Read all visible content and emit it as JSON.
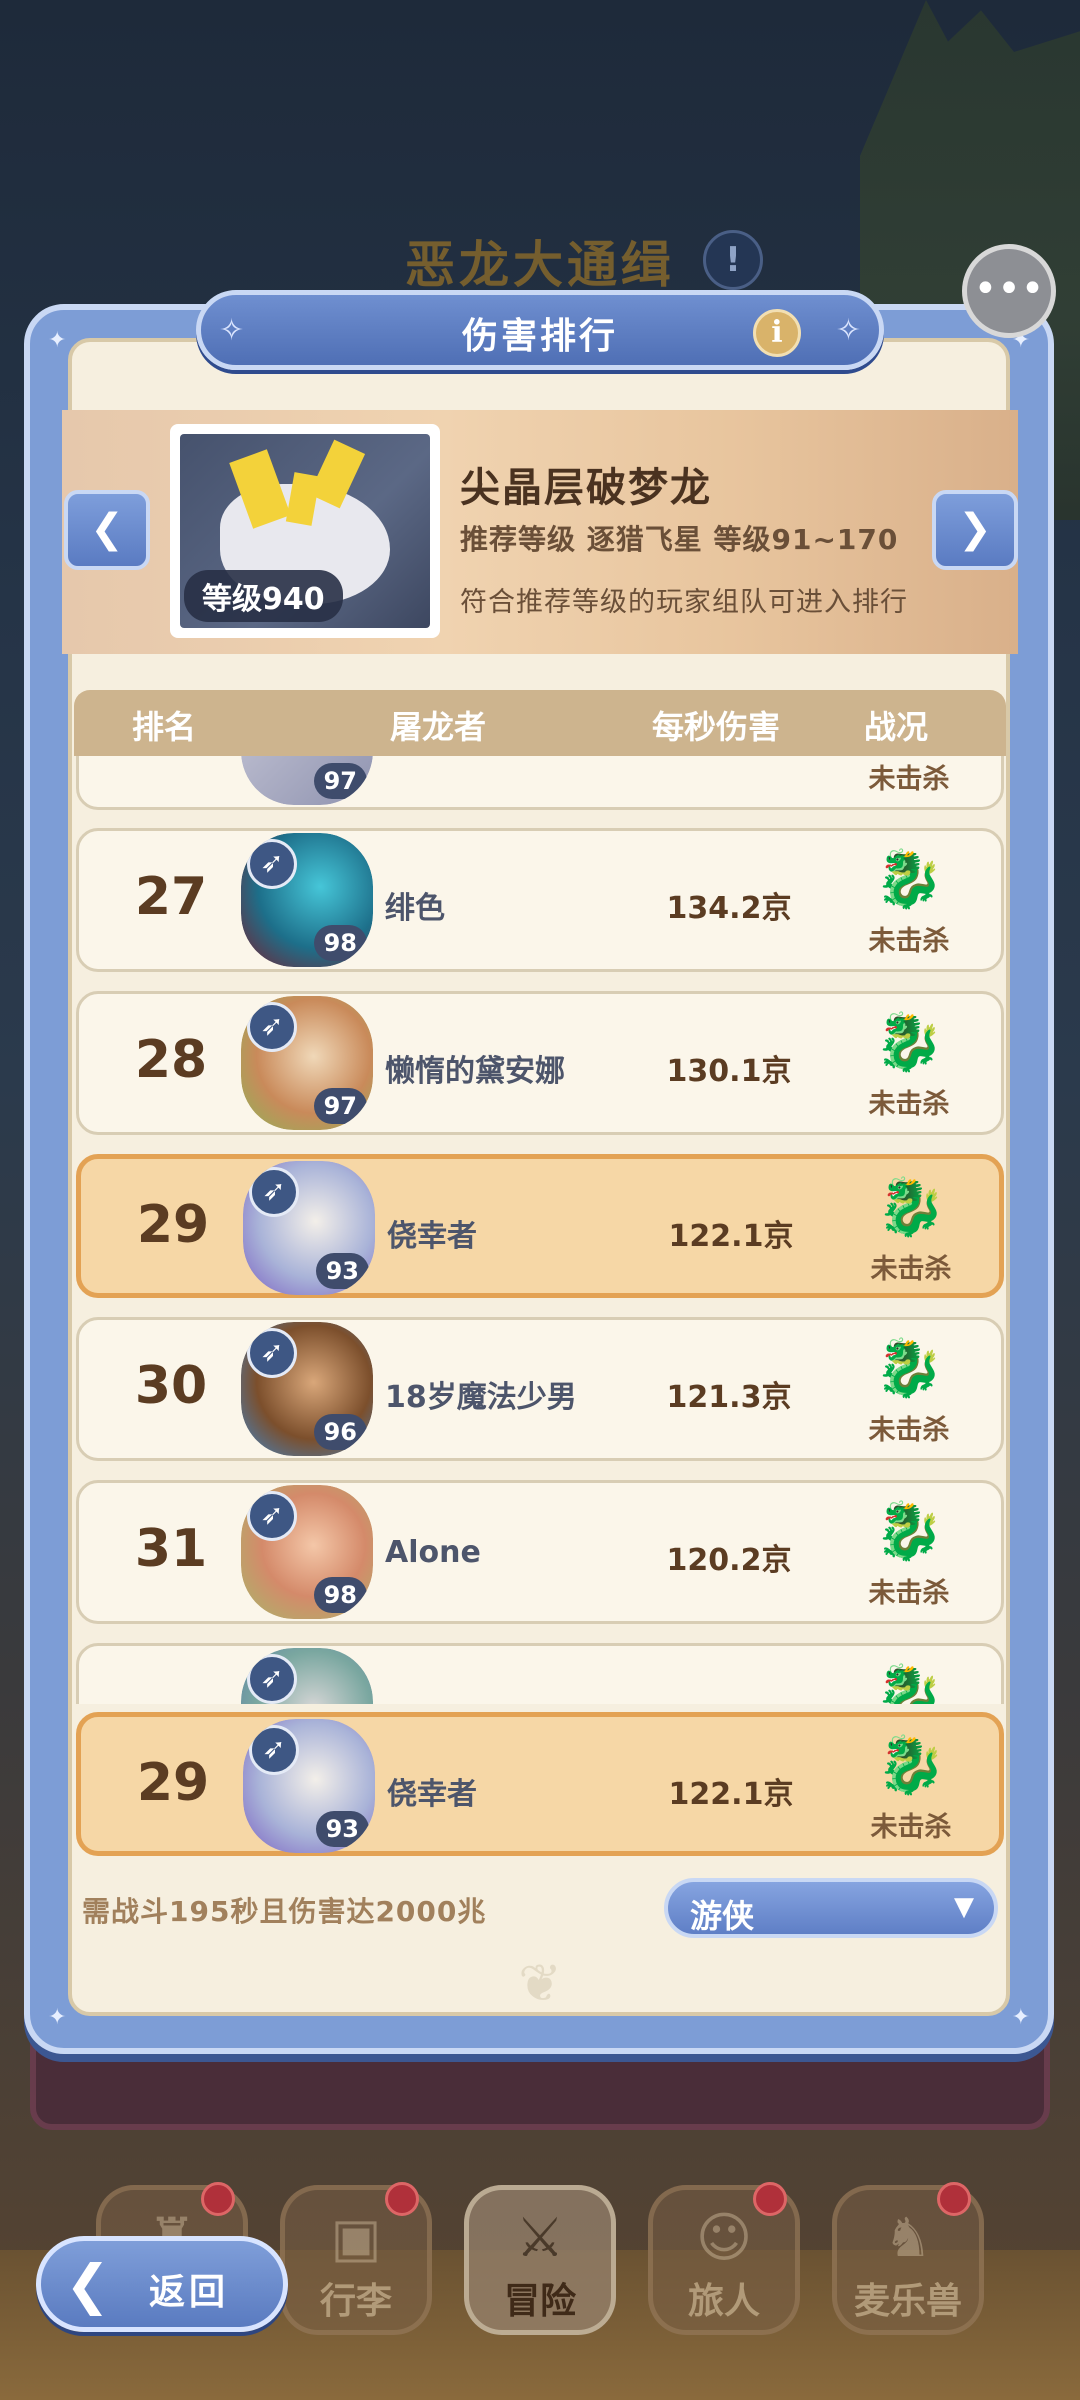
{
  "background": {
    "title": "恶龙大通缉",
    "title_icon": "!"
  },
  "modal": {
    "title": "伤害排行",
    "info_icon": "i"
  },
  "boss": {
    "name": "尖晶层破梦龙",
    "level_badge": "等级940",
    "recommend": "推荐等级 逐猎飞星 等级91~170",
    "note": "符合推荐等级的玩家组队可进入排行"
  },
  "list_header": {
    "rank": "排名",
    "slayer": "屠龙者",
    "dps": "每秒伤害",
    "result": "战况"
  },
  "rows": [
    {
      "rank": "",
      "name": "",
      "level": "97",
      "damage": "",
      "status": "未击杀",
      "highlight": false
    },
    {
      "rank": "27",
      "name": "绯色",
      "level": "98",
      "damage": "134.2京",
      "status": "未击杀",
      "highlight": false
    },
    {
      "rank": "28",
      "name": "懒惰的黛安娜",
      "level": "97",
      "damage": "130.1京",
      "status": "未击杀",
      "highlight": false
    },
    {
      "rank": "29",
      "name": "侥幸者",
      "level": "93",
      "damage": "122.1京",
      "status": "未击杀",
      "highlight": true
    },
    {
      "rank": "30",
      "name": "18岁魔法少男",
      "level": "96",
      "damage": "121.3京",
      "status": "未击杀",
      "highlight": false
    },
    {
      "rank": "31",
      "name": "Alone",
      "level": "98",
      "damage": "120.2京",
      "status": "未击杀",
      "highlight": false
    },
    {
      "rank": "32",
      "name": "",
      "level": "",
      "damage": "",
      "status": "",
      "highlight": false
    }
  ],
  "my_row": {
    "rank": "29",
    "name": "侥幸者",
    "level": "93",
    "damage": "122.1京",
    "status": "未击杀"
  },
  "requirement": "需战斗195秒且伤害达2000兆",
  "class_filter": {
    "selected": "游侠"
  },
  "bottom_nav": [
    {
      "label": "",
      "icon": "castle-icon"
    },
    {
      "label": "行李",
      "icon": "luggage-icon"
    },
    {
      "label": "冒险",
      "icon": "crossed-swords-icon"
    },
    {
      "label": "旅人",
      "icon": "traveler-icon"
    },
    {
      "label": "麦乐兽",
      "icon": "pet-icon"
    }
  ],
  "back_button": {
    "label": "返回"
  },
  "colors": {
    "modal_frame": "#7d9dd6",
    "panel_bg": "#f6efdf",
    "highlight_row": "#f6d7a6",
    "highlight_border": "#e3a254",
    "header_bar": "#cdb48e",
    "rank_text": "#5b3c22"
  }
}
